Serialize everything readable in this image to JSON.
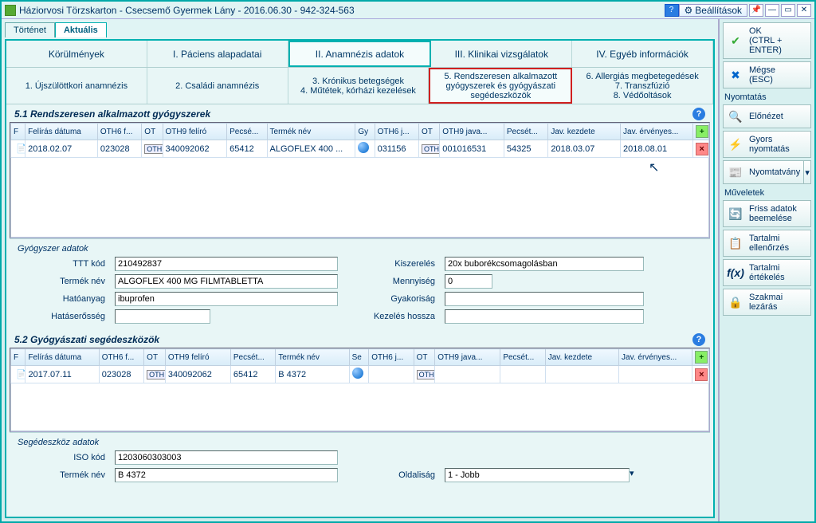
{
  "titlebar": {
    "title": "Háziorvosi Törzskarton - Csecsemő Gyermek Lány - 2016.06.30 - 942-324-563",
    "settings": "Beállítások"
  },
  "sidebar": {
    "ok": "OK\n(CTRL + ENTER)",
    "cancel": "Mégse\n(ESC)",
    "print_label": "Nyomtatás",
    "preview": "Előnézet",
    "quick_print": "Gyors nyomtatás",
    "form_print": "Nyomtatvány",
    "ops_label": "Műveletek",
    "refresh": "Friss adatok beemelése",
    "content_check": "Tartalmi ellenőrzés",
    "content_eval": "Tartalmi értékelés",
    "prof_lock": "Szakmai lezárás"
  },
  "view_tabs": {
    "history": "Történet",
    "current": "Aktuális"
  },
  "ptabs": {
    "t1": "Körülmények",
    "t2": "I. Páciens alapadatai",
    "t3": "II. Anamnézis adatok",
    "t4": "III. Klinikai vizsgálatok",
    "t5": "IV. Egyéb információk"
  },
  "stabs": {
    "s1": "1. Újszülöttkori anamnézis",
    "s2": "2. Családi anamnézis",
    "s3a": "3. Krónikus betegségek",
    "s3b": "4. Műtétek, kórházi kezelések",
    "s4a": "5. Rendszeresen alkalmazott gyógyszerek és gyógyászati segédeszközök",
    "s5a": "6. Allergiás megbetegedések",
    "s5b": "7. Transzfúzió",
    "s5c": "8. Védőoltások"
  },
  "section51": {
    "title": "5.1 Rendszeresen alkalmazott gyógyszerek",
    "headers": [
      "F",
      "Felírás dátuma",
      "OTH6 f...",
      "OT",
      "OTH9 felíró",
      "Pecsé...",
      "Termék név",
      "Gy",
      "OTH6 j...",
      "OT",
      "OTH9 java...",
      "Pecsét...",
      "Jav. kezdete",
      "Jav. érvényes..."
    ],
    "row": {
      "date": "2018.02.07",
      "oth6f": "023028",
      "ot1": "OTH",
      "oth9f": "340092062",
      "pecset1": "65412",
      "product": "ALGOFLEX 400 ...",
      "oth6j": "031156",
      "ot2": "OTH",
      "oth9j": "001016531",
      "pecset2": "54325",
      "jav_start": "2018.03.07",
      "jav_end": "2018.08.01"
    }
  },
  "med_form": {
    "title": "Gyógyszer adatok",
    "ttt_label": "TTT kód",
    "ttt": "210492837",
    "prod_label": "Termék név",
    "prod": "ALGOFLEX 400 MG FILMTABLETTA",
    "active_label": "Hatóanyag",
    "active": "ibuprofen",
    "strength_label": "Hatáserősség",
    "strength": "",
    "pack_label": "Kiszerelés",
    "pack": "20x buborékcsomagolásban",
    "qty_label": "Mennyiség",
    "qty": "0",
    "freq_label": "Gyakoriság",
    "freq": "",
    "dur_label": "Kezelés hossza",
    "dur": ""
  },
  "section52": {
    "title": "5.2 Gyógyászati segédeszközök",
    "headers": [
      "F",
      "Felírás dátuma",
      "OTH6 f...",
      "OT",
      "OTH9 felíró",
      "Pecsét...",
      "Termék név",
      "Se",
      "OTH6 j...",
      "OT",
      "OTH9 java...",
      "Pecsét...",
      "Jav. kezdete",
      "Jav. érvényes..."
    ],
    "row": {
      "date": "2017.07.11",
      "oth6f": "023028",
      "ot1": "OTH",
      "oth9f": "340092062",
      "pecset1": "65412",
      "product": "B 4372"
    }
  },
  "aid_form": {
    "title": "Segédeszköz adatok",
    "iso_label": "ISO kód",
    "iso": "1203060303003",
    "prod_label": "Termék név",
    "prod": "B 4372",
    "side_label": "Oldaliság",
    "side": "1 - Jobb"
  }
}
